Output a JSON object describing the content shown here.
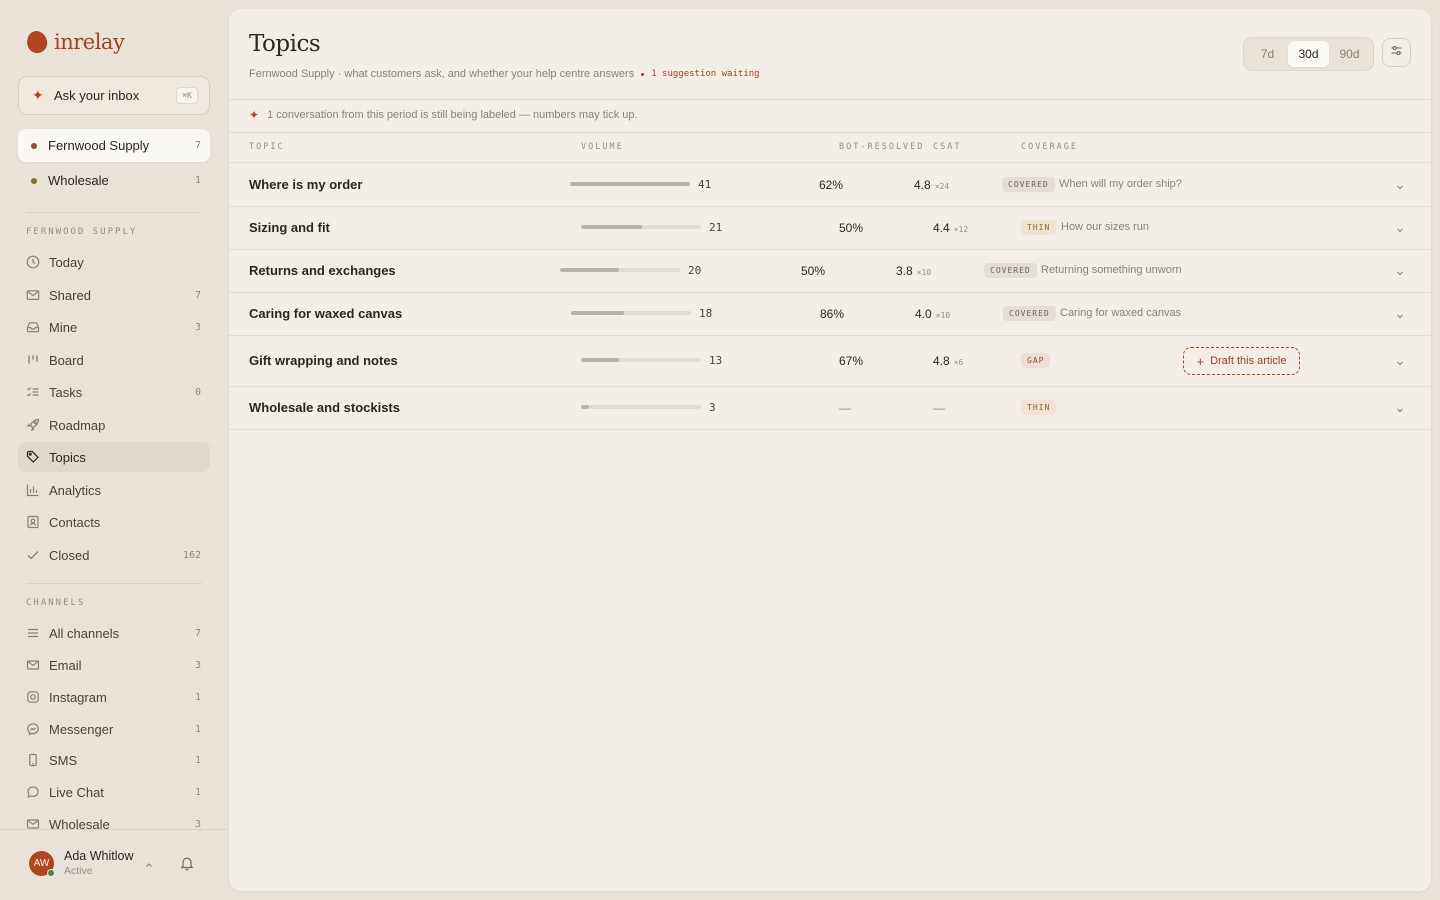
{
  "app": {
    "name": "inrelay"
  },
  "ask": {
    "label": "Ask your inbox",
    "shortcut": "⌘K"
  },
  "workspaces": [
    {
      "label": "Fernwood Supply",
      "count": "7",
      "color": "#b2451f"
    },
    {
      "label": "Wholesale",
      "count": "1",
      "color": "#8a6a32"
    }
  ],
  "sections": {
    "workspace": "FERNWOOD SUPPLY",
    "channels": "CHANNELS"
  },
  "nav": [
    {
      "label": "Today",
      "count": "",
      "icon": "clock-icon"
    },
    {
      "label": "Shared",
      "count": "7",
      "icon": "envelope-icon"
    },
    {
      "label": "Mine",
      "count": "3",
      "icon": "inbox-icon"
    },
    {
      "label": "Board",
      "count": "",
      "icon": "board-icon"
    },
    {
      "label": "Tasks",
      "count": "0",
      "icon": "tasks-icon"
    },
    {
      "label": "Roadmap",
      "count": "",
      "icon": "rocket-icon"
    },
    {
      "label": "Topics",
      "count": "",
      "icon": "tag-icon"
    },
    {
      "label": "Analytics",
      "count": "",
      "icon": "bar-chart-icon"
    },
    {
      "label": "Contacts",
      "count": "",
      "icon": "contact-card-icon"
    },
    {
      "label": "Closed",
      "count": "162",
      "icon": "check-icon"
    }
  ],
  "channels": [
    {
      "label": "All channels",
      "count": "7",
      "icon": "list-icon"
    },
    {
      "label": "Email",
      "count": "3",
      "icon": "mail-icon"
    },
    {
      "label": "Instagram",
      "count": "1",
      "icon": "instagram-icon"
    },
    {
      "label": "Messenger",
      "count": "1",
      "icon": "messenger-icon"
    },
    {
      "label": "SMS",
      "count": "1",
      "icon": "phone-icon"
    },
    {
      "label": "Live Chat",
      "count": "1",
      "icon": "chat-bubble-icon"
    },
    {
      "label": "Wholesale",
      "count": "3",
      "icon": "mail-icon"
    }
  ],
  "user": {
    "initials": "AW",
    "name": "Ada Whitlow",
    "status": "Active"
  },
  "page": {
    "title": "Topics",
    "subtitle": "Fernwood Supply · what customers ask, and whether your help centre answers",
    "suggestion": "1 suggestion waiting",
    "notice": "1 conversation from this period is still being labeled — numbers may tick up."
  },
  "range": {
    "options": [
      "7d",
      "30d",
      "90d"
    ],
    "selected": "30d"
  },
  "columns": {
    "topic": "TOPIC",
    "volume": "VOLUME",
    "bot_resolved": "BOT-RESOLVED",
    "csat": "CSAT",
    "coverage": "COVERAGE"
  },
  "rows": [
    {
      "topic": "Where is my order",
      "volume": "41",
      "volume_fraction": 1.0,
      "bot_resolved": "62%",
      "csat": "4.8",
      "csat_n": "×24",
      "coverage": "COVERED",
      "article": "When will my order ship?"
    },
    {
      "topic": "Sizing and fit",
      "volume": "21",
      "volume_fraction": 0.51,
      "bot_resolved": "50%",
      "csat": "4.4",
      "csat_n": "×12",
      "coverage": "THIN",
      "article": "How our sizes run"
    },
    {
      "topic": "Returns and exchanges",
      "volume": "20",
      "volume_fraction": 0.49,
      "bot_resolved": "50%",
      "csat": "3.8",
      "csat_n": "×10",
      "coverage": "COVERED",
      "article": "Returning something unworn"
    },
    {
      "topic": "Caring for waxed canvas",
      "volume": "18",
      "volume_fraction": 0.44,
      "bot_resolved": "86%",
      "csat": "4.0",
      "csat_n": "×10",
      "coverage": "COVERED",
      "article": "Caring for waxed canvas"
    },
    {
      "topic": "Gift wrapping and notes",
      "volume": "13",
      "volume_fraction": 0.32,
      "bot_resolved": "67%",
      "csat": "4.8",
      "csat_n": "×6",
      "coverage": "GAP",
      "action": "Draft this article"
    },
    {
      "topic": "Wholesale and stockists",
      "volume": "3",
      "volume_fraction": 0.07,
      "bot_resolved": "—",
      "csat": "—",
      "coverage": "THIN"
    }
  ]
}
